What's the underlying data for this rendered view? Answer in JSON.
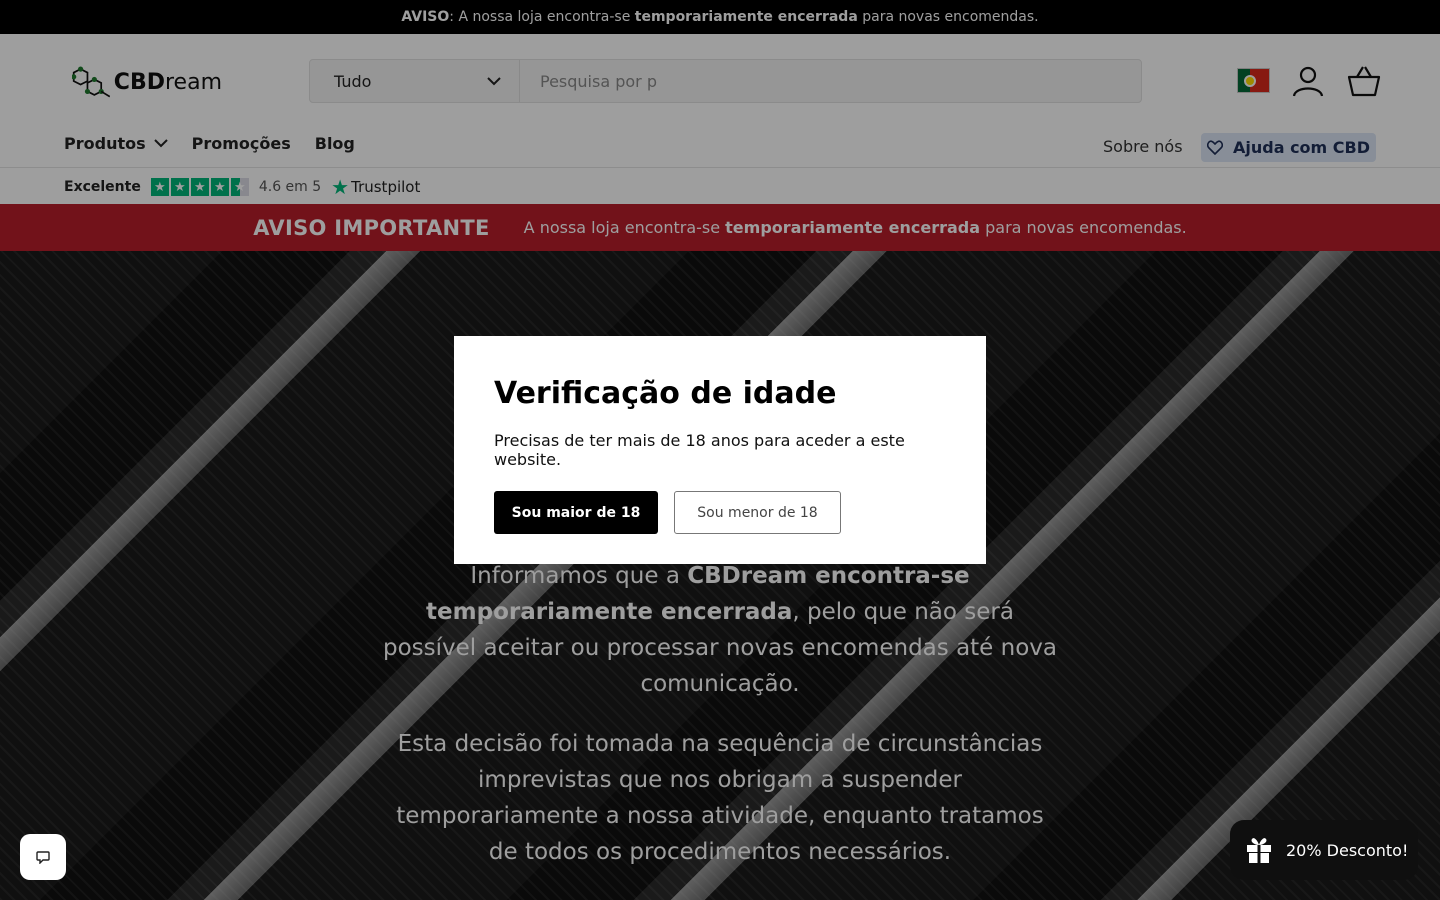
{
  "announcement": {
    "label": "AVISO",
    "text_before": ": A nossa loja encontra-se ",
    "bold": "temporariamente encerrada",
    "text_after": " para novas encomendas."
  },
  "header": {
    "logo_bold": "CBD",
    "logo_regular": "ream",
    "search": {
      "category": "Tudo",
      "placeholder": "Pesquisa por p"
    },
    "icons": [
      "portugal-flag-icon",
      "user-icon",
      "basket-icon"
    ]
  },
  "nav": {
    "items": [
      {
        "label": "Produtos",
        "has_dropdown": true
      },
      {
        "label": "Promoções"
      },
      {
        "label": "Blog"
      }
    ],
    "about": "Sobre nós",
    "help": "Ajuda com CBD"
  },
  "trustpilot": {
    "label": "Excelente",
    "rating": 4.6,
    "score_text": "4.6 em 5",
    "brand": "Trustpilot"
  },
  "notice": {
    "title": "AVISO IMPORTANTE",
    "text_before": "A nossa loja encontra-se ",
    "bold": "temporariamente encerrada",
    "text_after": " para novas encomendas."
  },
  "hero": {
    "p1_before": "Informamos que a ",
    "p1_bold": "CBDream encontra-se temporariamente encerrada",
    "p1_after": ", pelo que não será possível aceitar ou processar novas encomendas até nova comunicação.",
    "p2": "Esta decisão foi tomada na sequência de circunstâncias imprevistas que nos obrigam a suspender temporariamente a nossa atividade, enquanto tratamos de todos os procedimentos necessários."
  },
  "modal": {
    "title": "Verificação de idade",
    "text": "Precisas de ter mais de 18 anos para aceder a este website.",
    "yes_label": "Sou maior de 18",
    "no_label": "Sou menor de 18"
  },
  "widgets": {
    "discount": "20% Desconto!"
  },
  "colors": {
    "notice_red": "#b81d2b",
    "help_bg": "#dbe6f6",
    "trust_green": "#00b67a"
  }
}
